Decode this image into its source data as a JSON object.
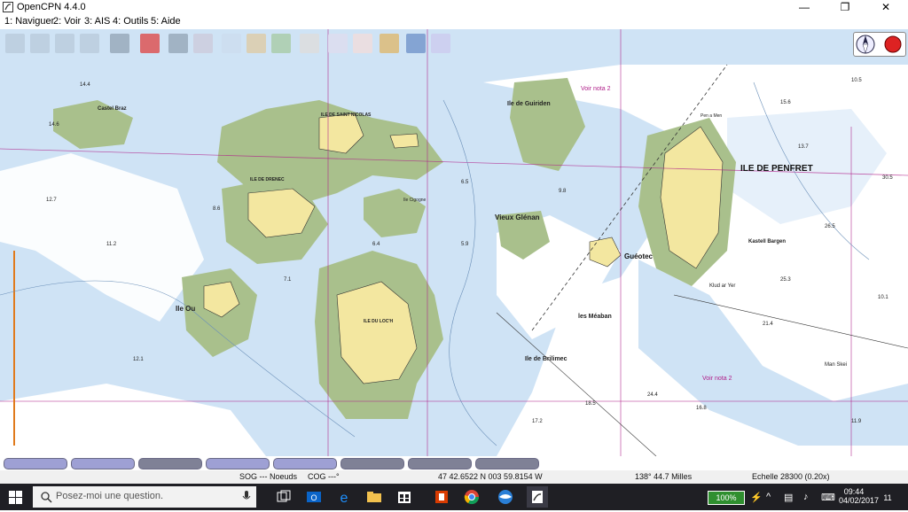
{
  "window": {
    "title": "OpenCPN 4.4.0",
    "minimize": "—",
    "maximize": "❐",
    "close": "✕"
  },
  "menu": [
    "1: Naviguer",
    "2: Voir",
    "3: AIS",
    "4: Outils",
    "5: Aide"
  ],
  "toolbar_icons": [
    "zoom-in-icon",
    "zoom-out-icon",
    "scale-in-icon",
    "scale-out-icon",
    "chart-select-icon",
    "auto-follow-icon",
    "settings-icon",
    "text-icon",
    "route-icon",
    "track-icon",
    "waypoint-icon",
    "print-icon",
    "route-manager-icon",
    "tide-icon",
    "current-icon",
    "help-icon",
    "ais-icon"
  ],
  "chart": {
    "islands": {
      "penfret": "ILE DE PENFRET",
      "st_nicolas": "ILE DE SAINT NICOLAS",
      "drenec": "ILE DE DRENEC",
      "loch": "ILE DU LOC'H",
      "guiriden": "Ile de Guiriden",
      "vieux_glenan": "Vieux Glénan",
      "guenotec": "Guéotec",
      "brilimec": "Ile de Brilimec",
      "meaban": "les Méaban",
      "castel_bargen": "Kastell Bargen",
      "castel_braz": "Castel Braz",
      "ile_ou": "Ile Ou",
      "cigogne": "Ile Cigogne",
      "penn_ar_men": "Pen a Men",
      "klud": "Klud ar Yer",
      "man_skei": "Man Skei"
    },
    "notes": {
      "voir_nota_top": "Voir nota 2",
      "voir_nota_bottom": "Voir nota 2"
    },
    "depths": [
      "14.4",
      "10.5",
      "15.6",
      "12.7",
      "11.2",
      "8.6",
      "7.1",
      "6.5",
      "9.8",
      "13.7",
      "26.5",
      "30.5",
      "25.3",
      "24.4",
      "16.8",
      "18.5",
      "17.2",
      "21.4",
      "12.1",
      "14.6",
      "6.4",
      "5.9",
      "10.1",
      "11.9"
    ]
  },
  "piano_keys": 8,
  "status": {
    "sog": "SOG --- Noeuds",
    "cog": "COG ---°",
    "position": "47 42.6522 N   003 59.8154 W",
    "bearing": "138°  44.7 Milles",
    "scale": "Echelle 28300 (0.20x)"
  },
  "taskbar": {
    "search_placeholder": "Posez-moi une question.",
    "apps": [
      "task-view-icon",
      "edge-icon",
      "file-explorer-icon",
      "store-icon",
      "office-icon",
      "chrome-icon",
      "thunderbird-icon",
      "opencpn-icon"
    ],
    "battery": "100%",
    "time": "09:44",
    "date": "04/02/2017",
    "notifications": "11"
  },
  "colors": {
    "deep_water": "#ffffff",
    "shallow_water": "#cfe3f5",
    "land": "#f3e7a0",
    "drying": "#a9c08c",
    "magenta": "#b0208a"
  }
}
